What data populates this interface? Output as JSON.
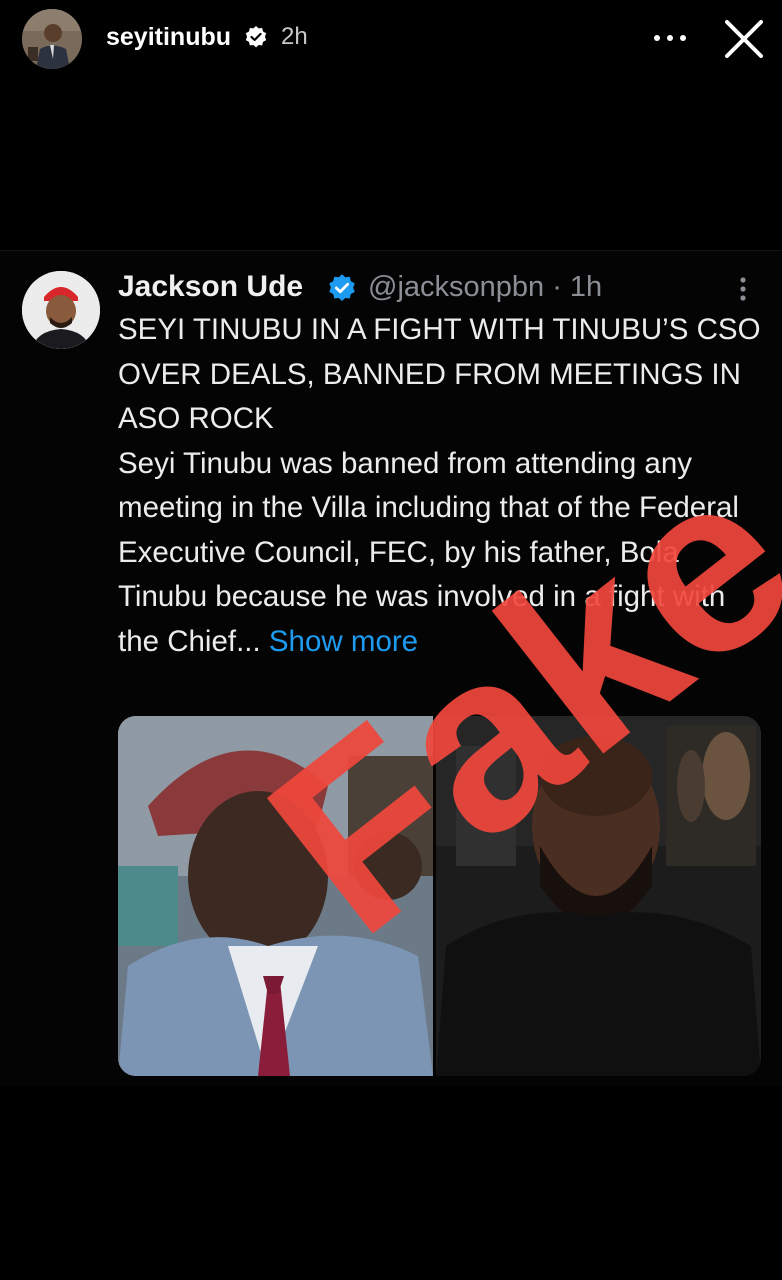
{
  "story": {
    "username": "seyitinubu",
    "time": "2h",
    "avatar_icon": "profile-photo",
    "more_icon": "ellipsis-horizontal-icon",
    "close_icon": "close-x-icon"
  },
  "tweet": {
    "author_name": "Jackson Ude",
    "handle_time": "@jacksonpbn · 1h",
    "headline": "SEYI TINUBU IN A FIGHT WITH TINUBU’S CSO OVER DEALS, BANNED FROM MEETINGS IN ASO ROCK",
    "body": "Seyi Tinubu was banned from attending any meeting in the Villa including that of the Federal Executive Council, FEC, by his father, Bola Tinubu because he was involved in a fight with the Chief...",
    "show_more": "Show more",
    "verified_color": "#1d9bf0",
    "link_color": "#1d9bf0"
  },
  "overlay": {
    "stamp_text": "Fake",
    "stamp_color": "#f0463c"
  }
}
